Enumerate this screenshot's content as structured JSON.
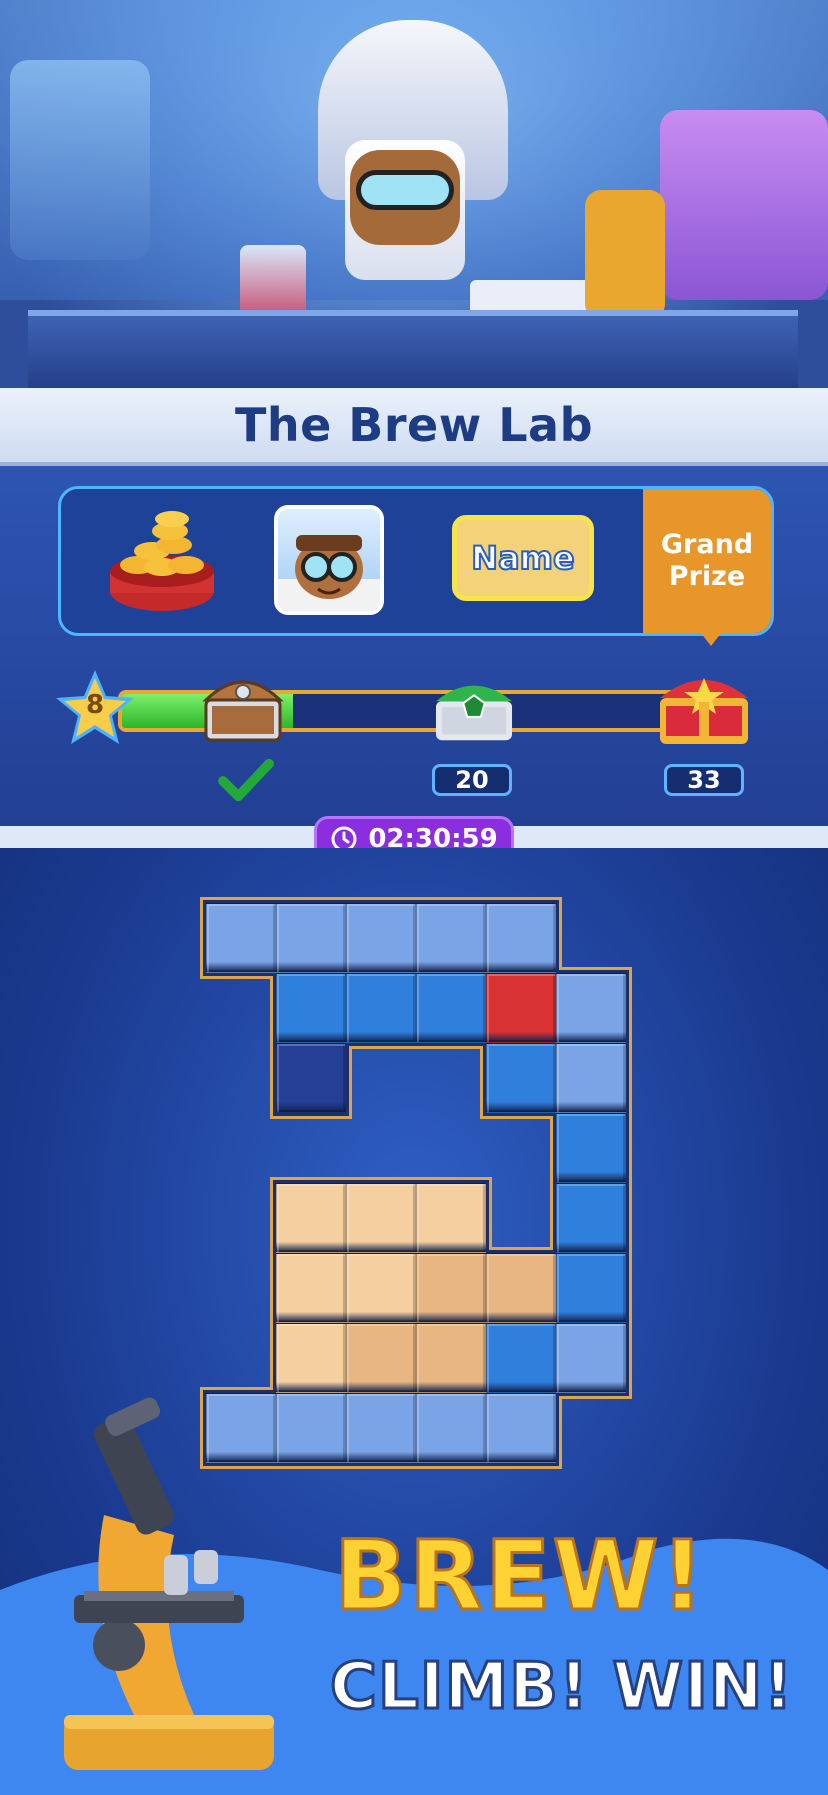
{
  "header": {
    "title": "The Brew Lab"
  },
  "rewards": {
    "grand_prize": "Grand Prize",
    "name_button": "Name",
    "items": [
      {
        "icon": "coin-bowl-icon"
      },
      {
        "icon": "character-avatar-icon"
      }
    ]
  },
  "progress": {
    "level": "8",
    "fill_fraction": 0.31,
    "milestones": [
      {
        "icon": "wooden-chest-icon",
        "value": "",
        "claimed": true
      },
      {
        "icon": "green-chest-icon",
        "value": "20",
        "claimed": false
      },
      {
        "icon": "red-chest-icon",
        "value": "33",
        "claimed": false
      }
    ]
  },
  "timer": {
    "value": "02:30:59",
    "icon": "clock-icon"
  },
  "board": {
    "colors": {
      "light": "#7aa4e6",
      "mid": "#2f7fdc",
      "dark": "#263f96",
      "red": "#d83232",
      "tan": "#f4cfa0",
      "tan2": "#e7b682"
    },
    "cells": [
      [
        "light",
        "light",
        "light",
        "light",
        "light",
        "",
        ""
      ],
      [
        "",
        "mid",
        "mid",
        "mid",
        "red",
        "light",
        ""
      ],
      [
        "",
        "dark",
        "",
        "",
        "mid",
        "light",
        ""
      ],
      [
        "",
        "",
        "",
        "",
        "",
        "mid",
        ""
      ],
      [
        "",
        "tan",
        "tan",
        "tan",
        "",
        "mid",
        ""
      ],
      [
        "",
        "tan",
        "tan",
        "tan2",
        "tan2",
        "mid",
        ""
      ],
      [
        "",
        "tan",
        "tan2",
        "tan2",
        "mid",
        "light",
        ""
      ],
      [
        "light",
        "light",
        "light",
        "light",
        "light",
        "",
        ""
      ]
    ]
  },
  "tagline": {
    "line1": "BREW!",
    "line2": "CLIMB! WIN!"
  },
  "colors": {
    "accent": "#e8962a",
    "panel": "#2d55b3",
    "timer": "#8a2ee0",
    "title": "#1e3c84"
  }
}
